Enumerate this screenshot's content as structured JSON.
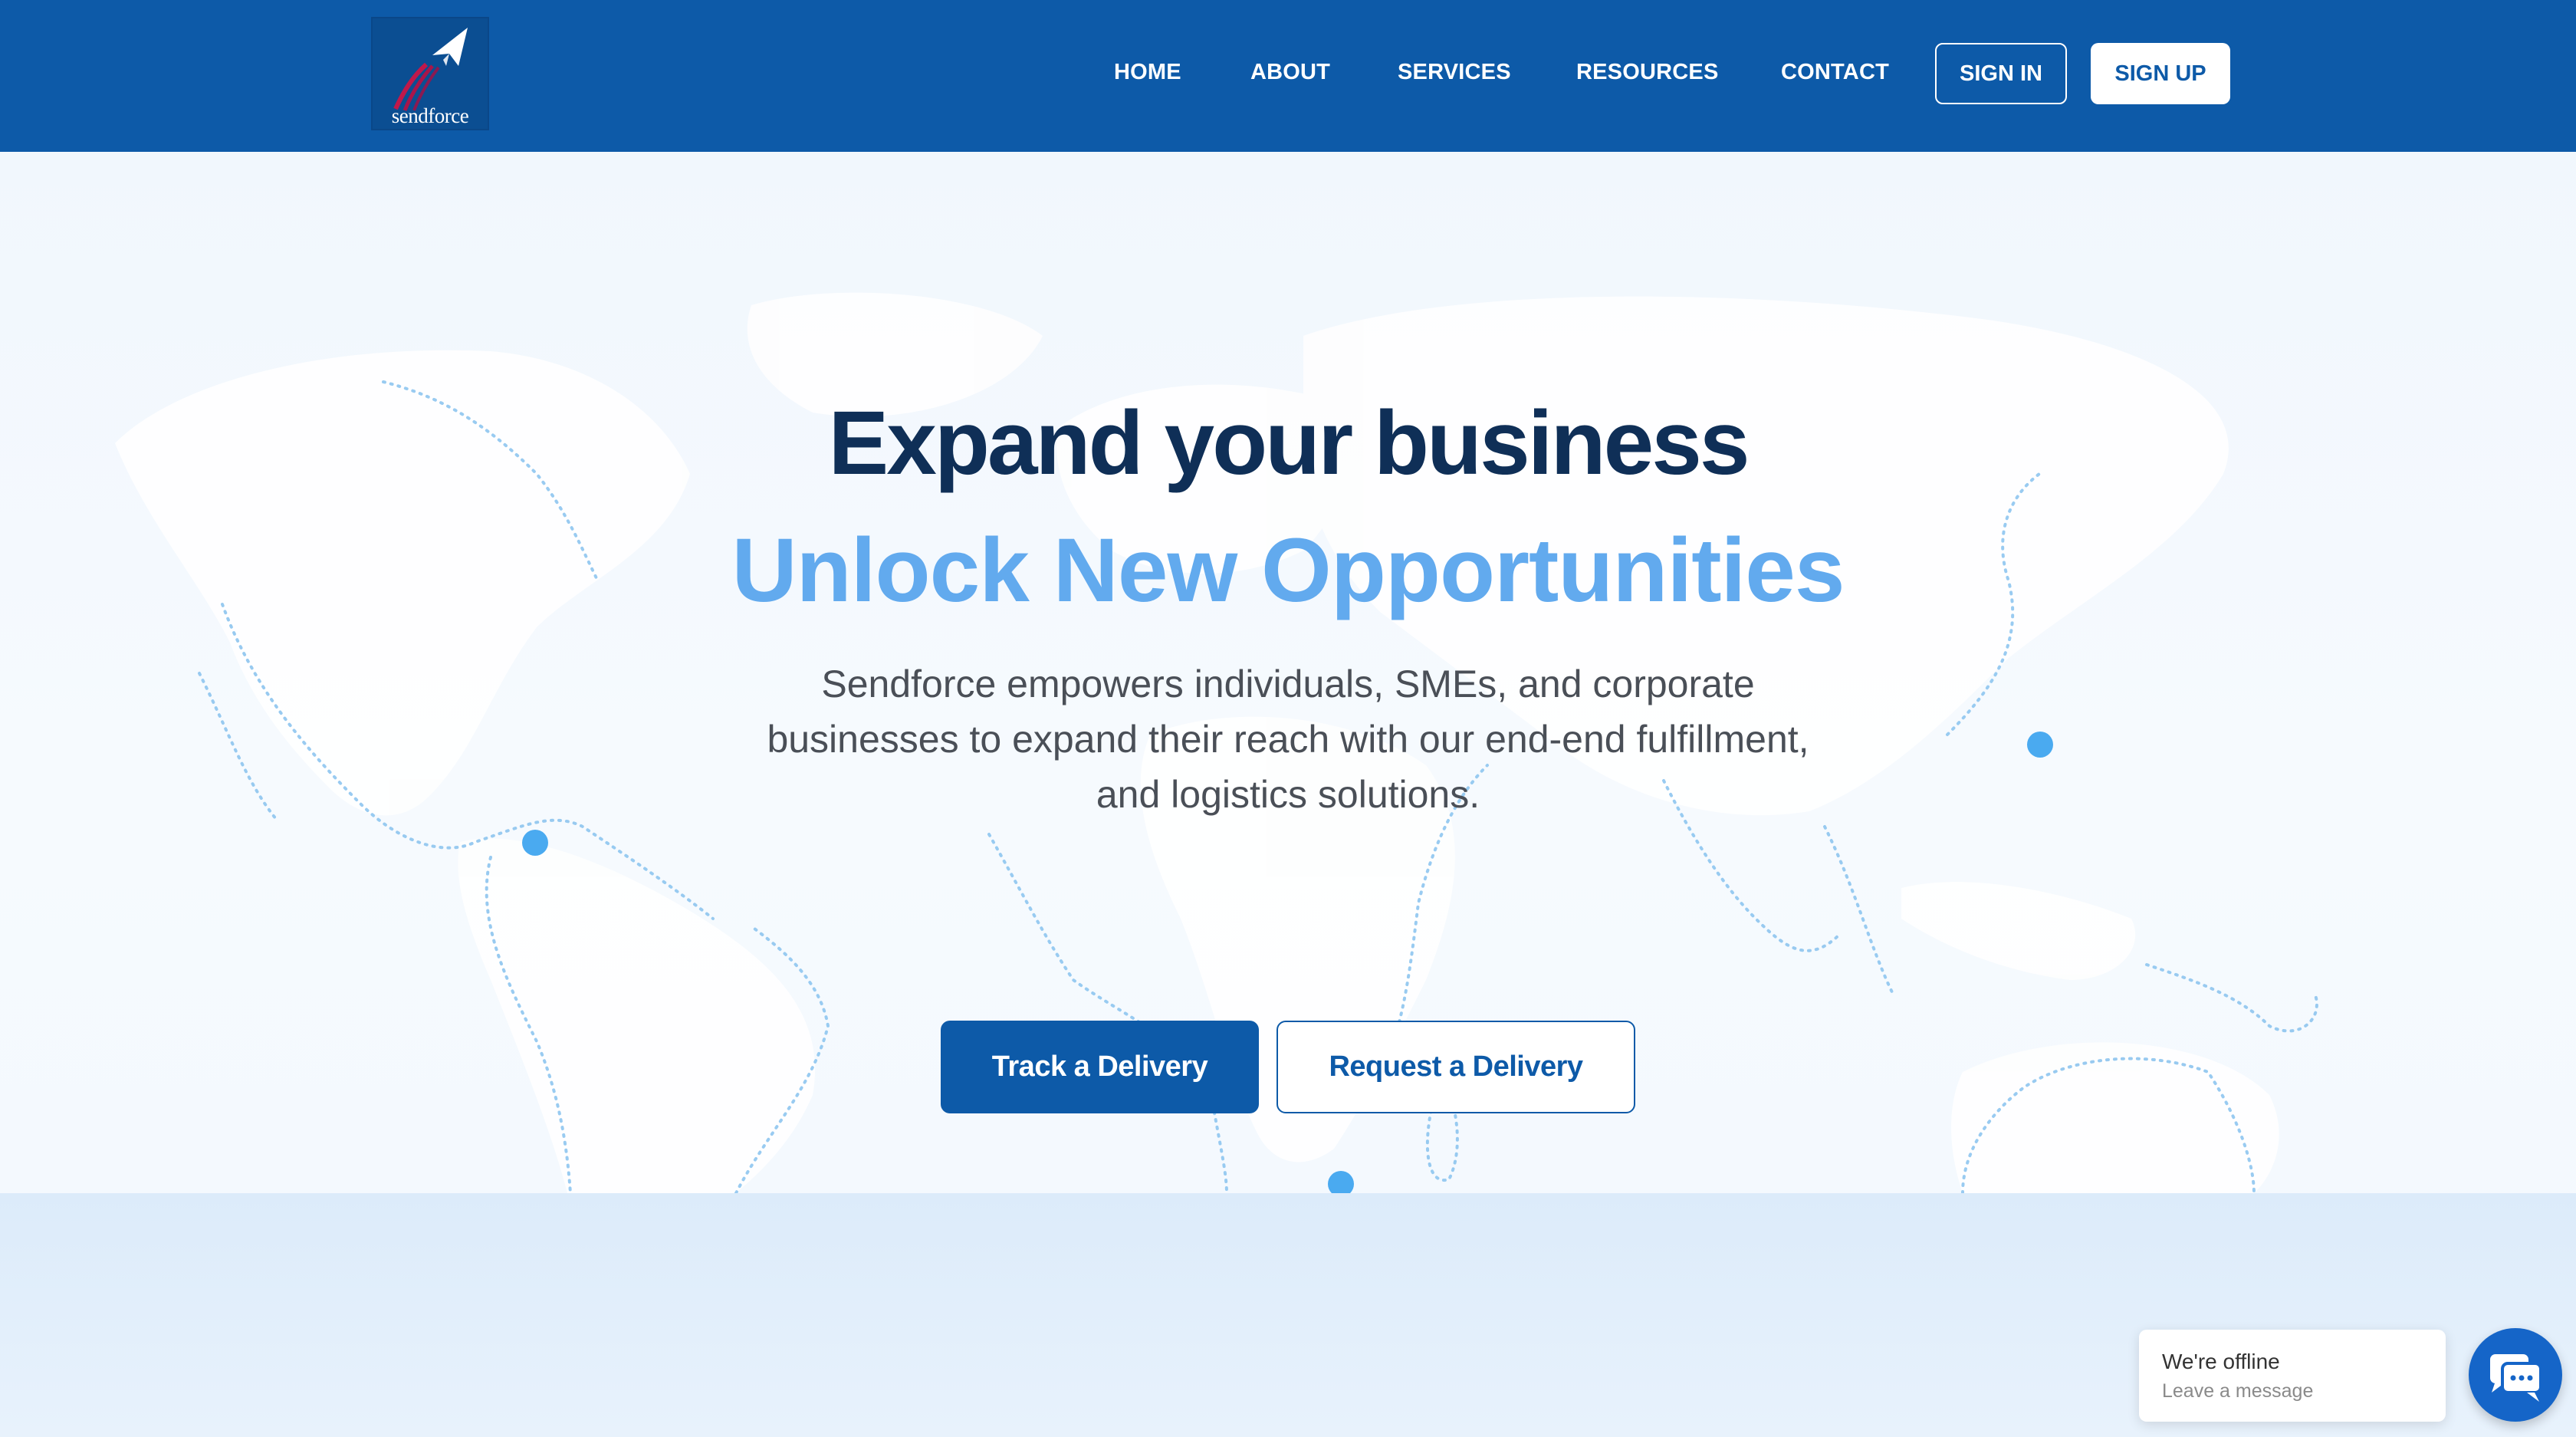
{
  "brand": {
    "name": "sendforce"
  },
  "nav": {
    "items": [
      {
        "label": "HOME"
      },
      {
        "label": "ABOUT"
      },
      {
        "label": "SERVICES"
      },
      {
        "label": "RESOURCES"
      },
      {
        "label": "CONTACT"
      }
    ],
    "sign_in": "SIGN IN",
    "sign_up": "SIGN UP"
  },
  "hero": {
    "title": "Expand your business",
    "subtitle": "Unlock New Opportunities",
    "description": "Sendforce empowers individuals, SMEs, and corporate businesses to expand their reach with our end-end fulfillment, and logistics solutions.",
    "primary_cta": "Track a Delivery",
    "secondary_cta": "Request a Delivery"
  },
  "chat": {
    "status": "We're offline",
    "prompt": "Leave a message",
    "icon": "chat-icon"
  },
  "colors": {
    "brand_blue": "#0d5aa8",
    "title_navy": "#0f2f57",
    "accent_light_blue": "#62aaee",
    "marker_blue": "#4aaaf0"
  }
}
